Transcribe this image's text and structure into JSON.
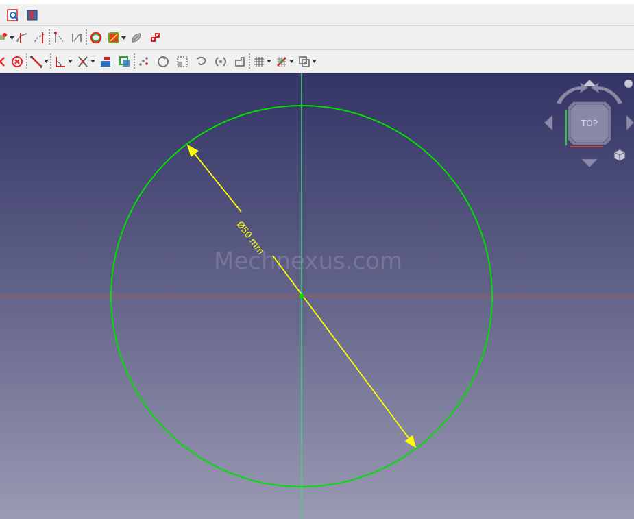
{
  "toolbar": {
    "row1": [
      {
        "name": "sketch-view-icon"
      },
      {
        "name": "view-section-icon"
      }
    ],
    "row2": [
      {
        "name": "external-geometry-icon",
        "dropdown": true
      },
      {
        "name": "trim-icon"
      },
      {
        "name": "extend-icon"
      },
      {
        "name": "constrain-vertical-distance-icon"
      },
      {
        "name": "constrain-horizontal-distance-icon"
      },
      {
        "name": "circle-icon"
      },
      {
        "name": "polygon-icon",
        "dropdown": true
      },
      {
        "name": "split-icon"
      },
      {
        "name": "symmetry-icon"
      }
    ],
    "row3": [
      {
        "name": "close-sketch-icon"
      },
      {
        "name": "cancel-icon"
      },
      {
        "name": "line-icon",
        "dropdown": true
      },
      {
        "name": "constrain-angle-icon",
        "dropdown": true
      },
      {
        "name": "constrain-coincident-icon",
        "dropdown": true
      },
      {
        "name": "constrain-block-icon"
      },
      {
        "name": "toggle-construction-icon"
      },
      {
        "name": "array-icon"
      },
      {
        "name": "rotate-copy-icon"
      },
      {
        "name": "scale-icon"
      },
      {
        "name": "mirror-icon"
      },
      {
        "name": "offset-icon"
      },
      {
        "name": "rectangular-array-icon"
      },
      {
        "name": "grid-icon",
        "dropdown": true
      },
      {
        "name": "snap-icon",
        "dropdown": true
      },
      {
        "name": "render-order-icon",
        "dropdown": true
      }
    ]
  },
  "viewport": {
    "watermark": "Mechnexus.com",
    "dimension_label": "Ø50 mm",
    "colors": {
      "circle": "#00e000",
      "dimension": "#ffff00",
      "h_axis": "#cc4444",
      "v_axis": "#44dd88"
    }
  },
  "navcube": {
    "face_label": "TOP"
  }
}
